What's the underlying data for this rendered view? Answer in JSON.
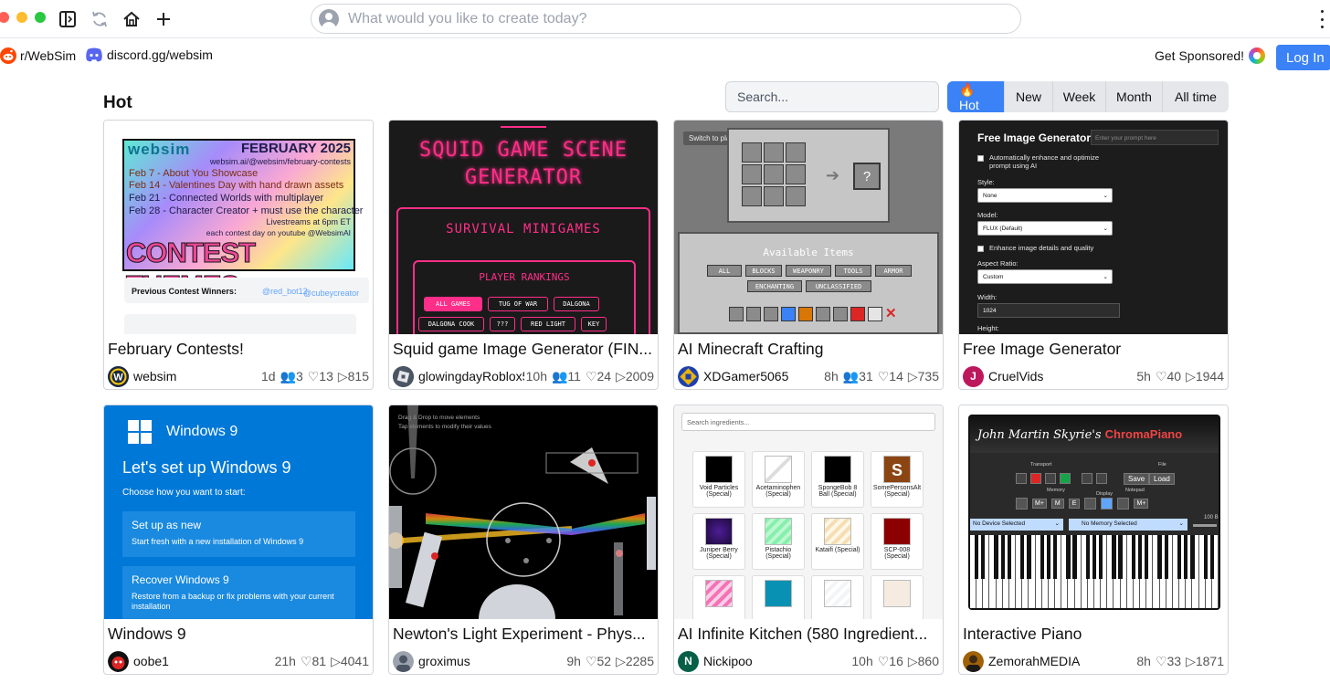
{
  "browser": {
    "prompt_placeholder": "What would you like to create today?"
  },
  "nav": {
    "reddit": "r/WebSim",
    "discord": "discord.gg/websim",
    "sponsor": "Get Sponsored!",
    "login": "Log In"
  },
  "section": {
    "title": "Hot",
    "search_placeholder": "Search...",
    "tabs": [
      "🔥 Hot",
      "New",
      "Week",
      "Month",
      "All time"
    ],
    "active_tab": "🔥 Hot"
  },
  "cards": [
    {
      "title": "February Contests!",
      "author": "websim",
      "stats": [
        "1d",
        "👥3",
        "♡13",
        "▷815"
      ],
      "avatar_color": "#1e3a8a"
    },
    {
      "title": "Squid game Image Generator (FIN...",
      "author": "glowingdayRoblox56",
      "stats": [
        "10h",
        "👥11",
        "♡24",
        "▷2009"
      ],
      "avatar_color": "#222222"
    },
    {
      "title": "AI Minecraft Crafting",
      "author": "XDGamer5065",
      "stats": [
        "8h",
        "👥31",
        "♡14",
        "▷735"
      ],
      "avatar_color": "#eab308"
    },
    {
      "title": "Free Image Generator",
      "author": "CruelVids",
      "stats": [
        "5h",
        "♡40",
        "▷1944"
      ],
      "avatar_color": "#be185d",
      "avatar_letter": "J"
    },
    {
      "title": "Windows 9",
      "author": "oobe1",
      "stats": [
        "21h",
        "♡81",
        "▷4041"
      ],
      "avatar_color": "#b91c1c"
    },
    {
      "title": "Newton's Light Experiment - Phys...",
      "author": "groximus",
      "stats": [
        "9h",
        "♡52",
        "▷2285"
      ],
      "avatar_color": "#6b7280"
    },
    {
      "title": "AI Infinite Kitchen (580 Ingredient...",
      "author": "Nickipoo",
      "stats": [
        "10h",
        "♡16",
        "▷860"
      ],
      "avatar_color": "#065f46",
      "avatar_letter": "N"
    },
    {
      "title": "Interactive Piano",
      "author": "ZemorahMEDIA",
      "stats": [
        "8h",
        "♡33",
        "▷1871"
      ],
      "avatar_color": "#78350f"
    }
  ],
  "thumbs": {
    "feb": {
      "brand": "websim",
      "date": "FEBRUARY 2025",
      "url": "websim.ai/@websim/february-contests",
      "lines": [
        "Feb 7 - About You Showcase",
        "Feb 14 - Valentines Day with hand drawn assets",
        "Feb 21 - Connected Worlds with multiplayer",
        "Feb 28 - Character Creator + must use the character"
      ],
      "livestream": "Livestreams at 6pm ET",
      "youtube": "each contest day on youtube @WebsimAI",
      "big": "CONTEST THEMES",
      "winners_label": "Previous Contest Winners:",
      "winner1": "@red_bot12",
      "winner2": "@cubeycreator"
    },
    "squid": {
      "title1": "SQUID GAME SCENE",
      "title2": "GENERATOR",
      "sub": "SURVIVAL MINIGAMES",
      "rank": "PLAYER RANKINGS",
      "chips": [
        "ALL GAMES",
        "TUG OF WAR",
        "DALGONA",
        "DALGONA COOK",
        "???",
        "RED LIGHT",
        "KEY"
      ]
    },
    "mc": {
      "switch": "Switch to place mode",
      "result": "?",
      "avail": "Available Items",
      "cats": [
        "ALL",
        "BLOCKS",
        "WEAPONRY",
        "TOOLS",
        "ARMOR",
        "ENCHANTING",
        "UNCLASSIFIED"
      ]
    },
    "fig": {
      "title": "Free Image Generator",
      "prompt_ph": "Enter your prompt here",
      "opt1": "Automatically enhance and optimize prompt using AI",
      "style_lbl": "Style:",
      "style_val": "None",
      "model_lbl": "Model:",
      "model_val": "FLUX (Default)",
      "opt2": "Enhance image details and quality",
      "aspect_lbl": "Aspect Ratio:",
      "aspect_val": "Custom",
      "width_lbl": "Width:",
      "width_val": "1024",
      "height_lbl": "Height:"
    },
    "w9": {
      "logo": "Windows 9",
      "heading": "Let's set up Windows 9",
      "choose": "Choose how you want to start:",
      "opt1_title": "Set up as new",
      "opt1_desc": "Start fresh with a new installation of Windows 9",
      "opt2_title": "Recover Windows 9",
      "opt2_desc": "Restore from a backup or fix problems with your current installation"
    },
    "newton": {
      "hint1": "Drag & Drop to move elements",
      "hint2": "Tap elements to modify their values"
    },
    "kitchen": {
      "search_ph": "Search ingredients...",
      "tiles": [
        {
          "name": "Void Particles (Special)",
          "color": "#000000"
        },
        {
          "name": "Acetaminophen (Special)",
          "color": "#f3f4f6"
        },
        {
          "name": "SpongeBob 8 Ball (Special)",
          "color": "#000000"
        },
        {
          "name": "SomePersonsAlt (Special)",
          "color": "#8b4513",
          "glyph": "S"
        },
        {
          "name": "Juniper Berry (Special)",
          "color": "#2e1065"
        },
        {
          "name": "Pistachio (Special)",
          "color": "#86efac"
        },
        {
          "name": "Kataifi (Special)",
          "color": "#f5deb3"
        },
        {
          "name": "SCP-008 (Special)",
          "color": "#8b0000"
        },
        {
          "name": "",
          "color": "#f472b6"
        },
        {
          "name": "",
          "color": "#0891b2"
        },
        {
          "name": "",
          "color": "#f3f4f6"
        },
        {
          "name": "",
          "color": "#f5ebe0"
        }
      ]
    },
    "piano": {
      "title_a": "John Martin Skyrie's",
      "title_b": "ChromaPiano",
      "transport": "Transport",
      "file": "File",
      "save": "Save",
      "load": "Load",
      "memory": "Memory",
      "display": "Display",
      "notepad": "Notepad",
      "m_plus": "M+",
      "m_letter": "M",
      "e_letter": "E",
      "device": "No Device Selected",
      "memsel": "No Memory Selected",
      "volume": "100 B"
    }
  }
}
